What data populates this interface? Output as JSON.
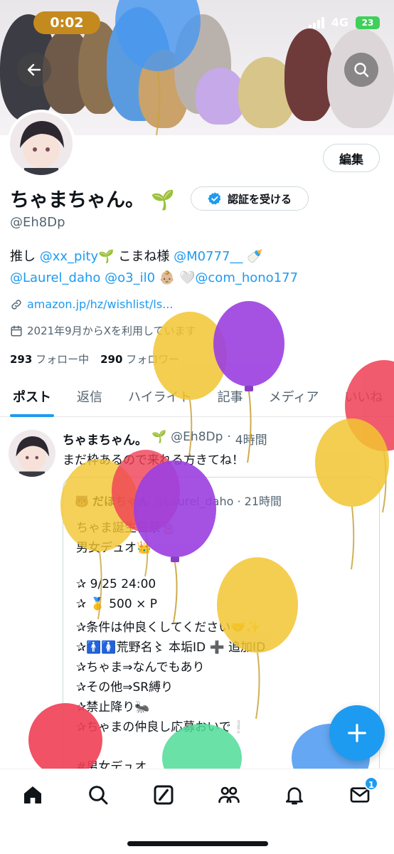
{
  "status_bar": {
    "time": "0:02",
    "network": "4G",
    "battery": "23"
  },
  "profile": {
    "display_name": "ちゃまちゃん。",
    "name_emoji": "🌱",
    "verify_label": "認証を受ける",
    "handle": "@Eh8Dp",
    "edit_label": "編集",
    "bio": {
      "line1_prefix": "推し ",
      "mention1": "@xx_pity",
      "line1_mid": " こまね様 ",
      "mention2": "@M0777__",
      "mention3": "@Laurel_daho",
      "mention4": "@o3_il0",
      "mention5": "@com_hono177"
    },
    "website": "amazon.jp/hz/wishlist/ls...",
    "joined": "2021年9月からXを利用しています",
    "following_count": "293",
    "following_label": "フォロー中",
    "followers_count": "290",
    "followers_label": "フォロワー"
  },
  "tabs": [
    "ポスト",
    "返信",
    "ハイライト",
    "記事",
    "メディア",
    "いいね"
  ],
  "tweet": {
    "name": "ちゃまちゃん。",
    "handle": "@Eh8Dp",
    "time": "4時間",
    "text": "まだ枠あるので来れる方きてね！",
    "quote": {
      "name": "だほちゃん",
      "handle": "@Laurel_daho",
      "time": "21時間",
      "lines": [
        "ちゃま誕生日祭🎂",
        "男女デュオ👑",
        "",
        "✰ 9/25 24:00",
        "✰ 🥇 500 × P",
        "✰条件は仲良くしてください🤝✨",
        "✰🚹🚺荒野名〻 本垢ID ➕ 追加ID",
        "✰ちゃま⇒なんでもあり",
        "✰その他⇒SR縛り",
        "✰禁止降り🐜",
        "✰ちゃまの仲良し応募おいで❕",
        "",
        "#男女デュオ"
      ]
    }
  },
  "nav": {
    "messages_badge": "1",
    "icons": [
      "home-icon",
      "search-icon",
      "grok-icon",
      "communities-icon",
      "notifications-icon",
      "messages-icon"
    ]
  },
  "colors": {
    "accent": "#1d9bf0",
    "text": "#0f1419",
    "secondary": "#536471"
  }
}
